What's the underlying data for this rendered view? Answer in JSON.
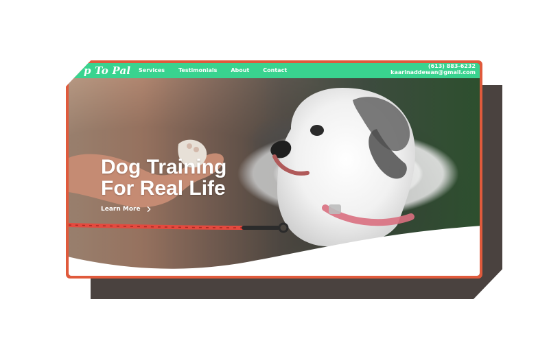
{
  "header": {
    "brand": "p To Pal",
    "nav": [
      {
        "label": "Services"
      },
      {
        "label": "Testimonials"
      },
      {
        "label": "About"
      },
      {
        "label": "Contact"
      }
    ],
    "phone": "(613) 883-6232",
    "email": "kaarinaddewan@gmail.com"
  },
  "hero": {
    "headline_line1": "Dog Training",
    "headline_line2": "For Real Life",
    "cta_label": "Learn More"
  },
  "colors": {
    "accent_green": "#39d38f",
    "frame_orange": "#e05a3c",
    "shadow_frame": "#4a423f",
    "text_white": "#ffffff"
  },
  "icons": {
    "cta_arrow": "chevron-right-icon"
  }
}
